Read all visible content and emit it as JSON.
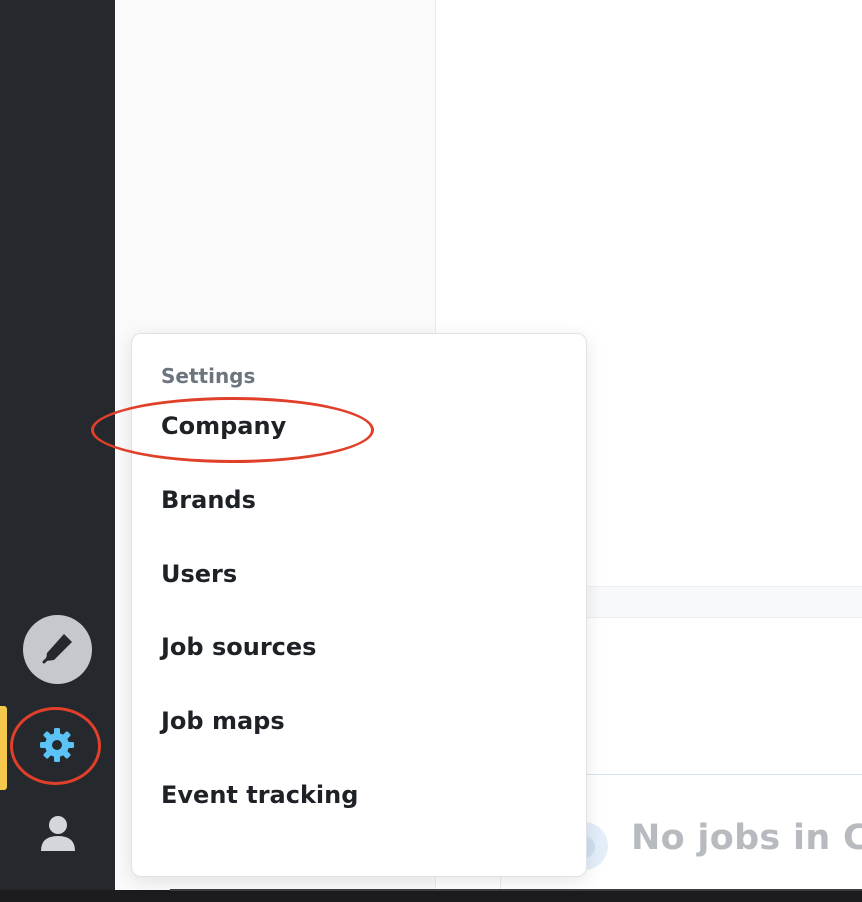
{
  "nav_rail": {
    "items": [
      {
        "icon": "pen-icon"
      },
      {
        "icon": "gear-icon",
        "active": true
      },
      {
        "icon": "user-icon"
      }
    ],
    "active_indicator_color": "#f5c84c",
    "gear_color": "#5bc3f5"
  },
  "settings_menu": {
    "heading": "Settings",
    "items": [
      {
        "label": "Company"
      },
      {
        "label": "Brands"
      },
      {
        "label": "Users"
      },
      {
        "label": "Job sources"
      },
      {
        "label": "Job maps"
      },
      {
        "label": "Event tracking"
      }
    ]
  },
  "main": {
    "empty_state_text": "No jobs in Ca"
  },
  "annotations": {
    "highlight_color": "#e0402a"
  }
}
